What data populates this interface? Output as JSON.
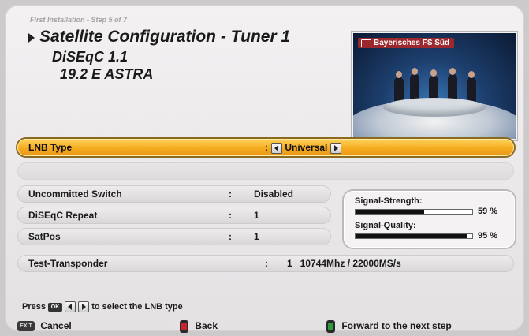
{
  "header": {
    "step": "First Installation - Step 5 of 7",
    "title": "Satellite Configuration - Tuner 1",
    "subtitle1": "DiSEqC 1.1",
    "subtitle2": "19.2 E ASTRA"
  },
  "preview": {
    "channel": "Bayerisches FS Süd"
  },
  "rows": {
    "lnb_type": {
      "label": "LNB Type",
      "sep": ":",
      "value": "Universal"
    },
    "uncommitted_switch": {
      "label": "Uncommitted Switch",
      "sep": ":",
      "value": "Disabled"
    },
    "diseqc_repeat": {
      "label": "DiSEqC Repeat",
      "sep": ":",
      "value": "1"
    },
    "satpos": {
      "label": "SatPos",
      "sep": ":",
      "value": "1"
    },
    "test_transponder": {
      "label": "Test-Transponder",
      "sep": ":",
      "value": "1   10744Mhz / 22000MS/s"
    }
  },
  "signal": {
    "strength_label": "Signal-Strength:",
    "strength_value": 59,
    "strength_text": "59 %",
    "quality_label": "Signal-Quality:",
    "quality_value": 95,
    "quality_text": "95 %"
  },
  "hint": {
    "press": "Press",
    "ok_key": "OK",
    "suffix": "to select the LNB type"
  },
  "footer": {
    "exit_key": "EXIT",
    "cancel": "Cancel",
    "back": "Back",
    "forward": "Forward to the next step"
  },
  "colors": {
    "selected_row": "#f4a81c",
    "red_key": "#c8222a",
    "green_key": "#2f9a3c"
  }
}
